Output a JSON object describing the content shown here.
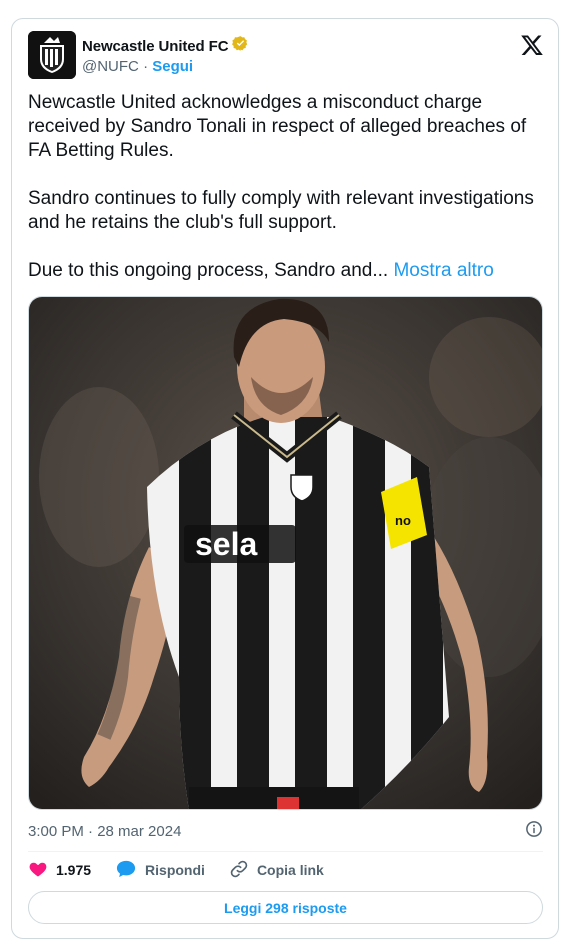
{
  "account": {
    "name": "Newcastle United FC",
    "handle": "@NUFC",
    "separator": "·",
    "follow_label": "Segui"
  },
  "tweet": {
    "paragraphs": [
      "Newcastle United acknowledges a misconduct charge received by Sandro Tonali in respect of alleged breaches of FA Betting Rules.",
      "Sandro continues to fully comply with relevant investigations and he retains the club's full support."
    ],
    "truncated_text": "Due to this ongoing process, Sandro and...",
    "show_more_label": "Mostra altro"
  },
  "media": {
    "sponsor_text": "sela",
    "sleeve_patch_text": "no"
  },
  "meta": {
    "timestamp": "3:00 PM · 28 mar 2024"
  },
  "actions": {
    "likes_count": "1.975",
    "reply_label": "Rispondi",
    "copy_link_label": "Copia link"
  },
  "read_replies_label": "Leggi 298 risposte",
  "colors": {
    "accent": "#1d9bf0",
    "like": "#f91880",
    "verified": "#e2b719"
  }
}
